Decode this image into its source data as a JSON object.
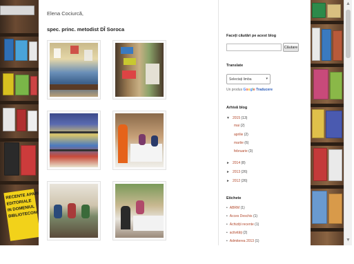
{
  "post": {
    "author": "Elena Cociurcă,",
    "role": "spec. princ. metodist DÎ Soroca",
    "photos": [
      {
        "icon": "photo-library-exhibition-1"
      },
      {
        "icon": "photo-library-exhibition-2"
      },
      {
        "icon": "photo-book-display"
      },
      {
        "icon": "photo-meeting-women-1"
      },
      {
        "icon": "photo-meeting-women-2"
      },
      {
        "icon": "photo-meeting-women-3"
      }
    ]
  },
  "sidebar": {
    "search": {
      "title": "Faceți căutări pe acest blog",
      "placeholder": "",
      "button": "Căutare"
    },
    "translate": {
      "title": "Translate",
      "select_label": "Selectați limba",
      "powered_prefix": "Un produs",
      "google_g": "G",
      "google_o1": "o",
      "google_o2": "o",
      "google_g2": "g",
      "google_l": "l",
      "google_e": "e",
      "service": "Traducere"
    },
    "archive": {
      "title": "Arhivă blog",
      "expanded_year": {
        "toggle": "▼",
        "label": "2015",
        "count": "(13)"
      },
      "months": [
        {
          "label": "mai",
          "count": "(2)"
        },
        {
          "label": "aprilie",
          "count": "(2)"
        },
        {
          "label": "martie",
          "count": "(6)"
        },
        {
          "label": "februarie",
          "count": "(3)"
        }
      ],
      "years": [
        {
          "toggle": "►",
          "label": "2014",
          "count": "(8)"
        },
        {
          "toggle": "►",
          "label": "2013",
          "count": "(26)"
        },
        {
          "toggle": "►",
          "label": "2012",
          "count": "(26)"
        }
      ]
    },
    "labels": {
      "title": "Etichete",
      "items": [
        {
          "label": "ABRM",
          "count": "(1)"
        },
        {
          "label": "Acces Deschis",
          "count": "(1)"
        },
        {
          "label": "Achiziții recente",
          "count": "(1)"
        },
        {
          "label": "activități",
          "count": "(2)"
        },
        {
          "label": "Admiterea 2013",
          "count": "(1)"
        }
      ]
    }
  },
  "background": {
    "poster_lines": [
      "RECENTE APARI",
      "EDITORIALE",
      "IN DOMENIUL",
      "BIBLIOTECONO"
    ]
  },
  "colors": {
    "link": "#b2472a",
    "shelf": "#6b4a32",
    "poster": "#f2d21a"
  }
}
